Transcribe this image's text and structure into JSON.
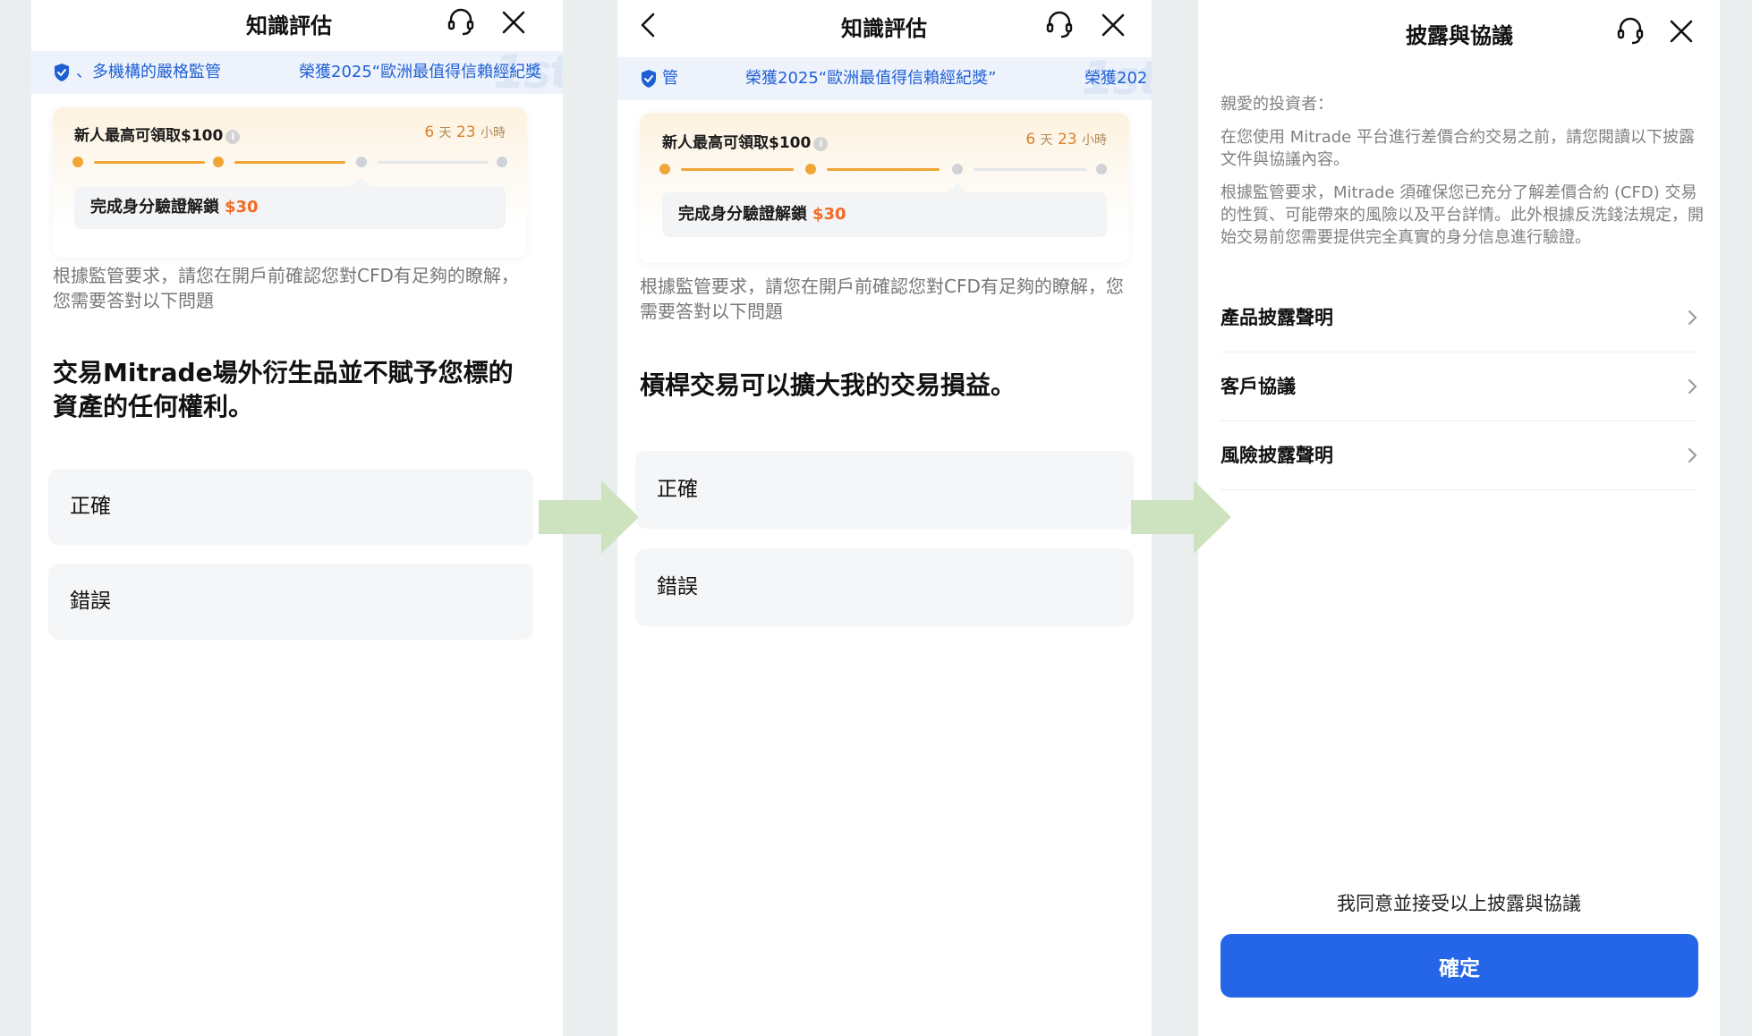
{
  "panel1": {
    "title": "知識評估",
    "banner": {
      "text_left": "、多機構的嚴格監管",
      "text_right": "榮獲2025“歐洲最值得信賴經紀獎"
    },
    "promo": {
      "title": "新人最高可領取$100",
      "countdown_days": "6",
      "countdown_days_unit": "天",
      "countdown_hours": "23",
      "countdown_hours_unit": "小時",
      "unlock_text": "完成身分驗證解鎖",
      "unlock_amount": "$30"
    },
    "description": "根據監管要求，請您在開戶前確認您對CFD有足夠的瞭解，您需要答對以下問題",
    "question": "交易Mitrade場外衍生品並不賦予您標的資產的任何權利。",
    "options": [
      "正確",
      "錯誤"
    ]
  },
  "panel2": {
    "title": "知識評估",
    "banner": {
      "text_left": "管",
      "text_mid": "榮獲2025“歐洲最值得信賴經紀獎”",
      "text_right": "榮獲202"
    },
    "promo": {
      "title": "新人最高可領取$100",
      "countdown_days": "6",
      "countdown_days_unit": "天",
      "countdown_hours": "23",
      "countdown_hours_unit": "小時",
      "unlock_text": "完成身分驗證解鎖",
      "unlock_amount": "$30"
    },
    "description": "根據監管要求，請您在開戶前確認您對CFD有足夠的瞭解，您需要答對以下問題",
    "question": "槓桿交易可以擴大我的交易損益。",
    "options": [
      "正確",
      "錯誤"
    ]
  },
  "panel3": {
    "title": "披露與協議",
    "greeting": "親愛的投資者：",
    "para1": "在您使用 Mitrade 平台進行差價合約交易之前，請您閱讀以下披露文件與協議內容。",
    "para2": "根據監管要求，Mitrade 須確保您已充分了解差價合約 (CFD) 交易的性質、可能帶來的風險以及平台詳情。此外根據反洗錢法規定，開始交易前您需要提供完全真實的身分信息進行驗證。",
    "items": [
      "產品披露聲明",
      "客戶協議",
      "風險披露聲明"
    ],
    "agree_text": "我同意並接受以上披露與協議",
    "confirm_label": "確定"
  },
  "colors": {
    "accent_blue": "#2566e8",
    "promo_orange": "#f0a534",
    "amount_orange": "#f36a23",
    "arrow_green": "#cde3bf"
  }
}
